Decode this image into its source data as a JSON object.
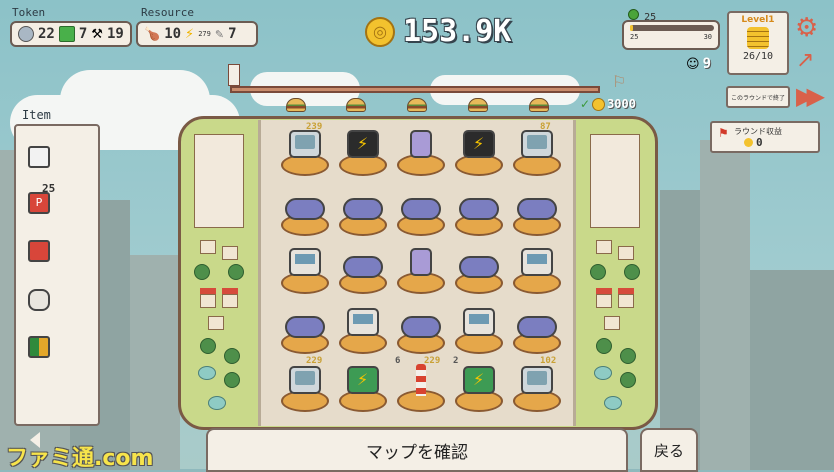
{
  "token": {
    "label": "Token",
    "items": [
      {
        "icon": "silver-coin-icon",
        "value": "22"
      },
      {
        "icon": "green-ticket-icon",
        "value": "7"
      },
      {
        "icon": "hammer-icon",
        "value": "19"
      }
    ]
  },
  "resource": {
    "label": "Resource",
    "items": [
      {
        "icon": "drumstick-icon",
        "value": "10"
      },
      {
        "icon": "lightning-icon",
        "value": "279",
        "value2": "7"
      }
    ]
  },
  "money": {
    "value": "153.9K",
    "icon": "gold-coin-icon"
  },
  "progress": {
    "level": "25",
    "min": "25",
    "max": "30",
    "fill_percent": 4
  },
  "level_card": {
    "title": "Level1",
    "value": "26/10"
  },
  "population": {
    "value": "9"
  },
  "goal": {
    "value": "3000"
  },
  "end_round_button": "このラウンドで終了",
  "round_income": {
    "label": "ラウンド収益",
    "value": "0"
  },
  "item_panel": {
    "title": "Item",
    "items": [
      {
        "name": "cassette-item",
        "count": ""
      },
      {
        "name": "parking-ticket-item",
        "count": "25"
      },
      {
        "name": "toolbox-item",
        "count": ""
      },
      {
        "name": "rice-cooker-item",
        "count": ""
      },
      {
        "name": "battery-item",
        "count": ""
      }
    ]
  },
  "board": {
    "top_counts": [
      "239",
      "87"
    ],
    "bottom_counts": [
      "229",
      "6",
      "229",
      "2",
      "102"
    ],
    "rows": [
      [
        "tv",
        "dark-bolt",
        "handheld",
        "dark-bolt",
        "tv"
      ],
      [
        "gamepad",
        "gamepad",
        "gamepad",
        "gamepad",
        "gamepad"
      ],
      [
        "pc",
        "gamepad",
        "handheld",
        "gamepad",
        "pc"
      ],
      [
        "gamepad",
        "pc",
        "gamepad",
        "pc",
        "gamepad"
      ],
      [
        "tv",
        "shop-bolt",
        "tower",
        "shop-bolt",
        "tv"
      ]
    ]
  },
  "bottom": {
    "confirm_map": "マップを確認",
    "back": "戻る"
  },
  "watermark": "ファミ通.com"
}
